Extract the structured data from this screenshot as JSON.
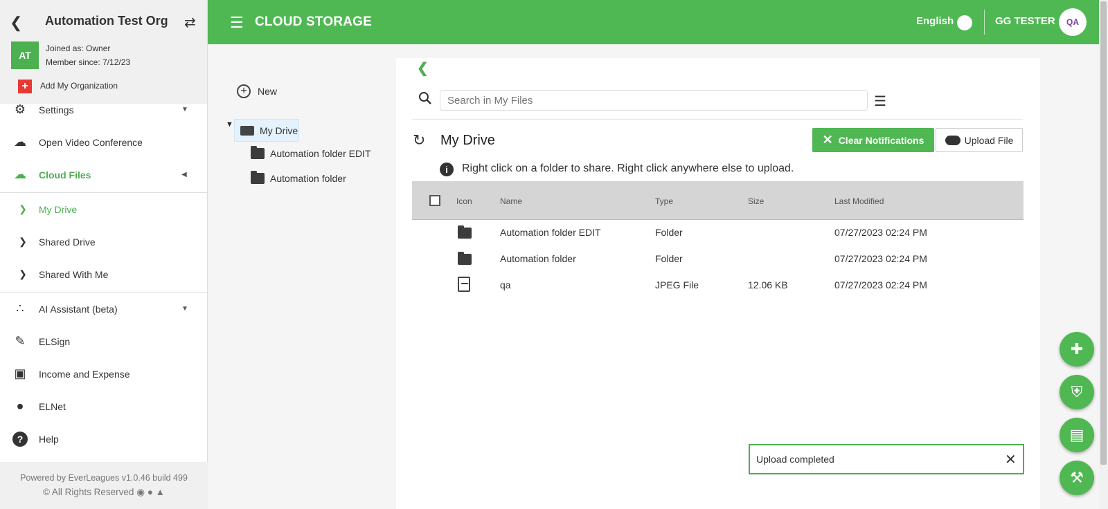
{
  "org": {
    "title": "Automation Test Org",
    "avatar_initials": "AT",
    "joined": "Joined as: Owner",
    "member_since": "Member since: 7/12/23",
    "add_org": "Add My Organization"
  },
  "sidebar": {
    "items": [
      {
        "label": "Settings",
        "icon": "gear-icon"
      },
      {
        "label": "Open Video Conference",
        "icon": "cloud-video-icon"
      },
      {
        "label": "Cloud Files",
        "icon": "cloud-icon"
      },
      {
        "label": "My Drive",
        "icon": "chevron-right-icon"
      },
      {
        "label": "Shared Drive",
        "icon": "chevron-right-icon"
      },
      {
        "label": "Shared With Me",
        "icon": "chevron-right-icon"
      },
      {
        "label": "AI Assistant (beta)",
        "icon": "ai-icon"
      },
      {
        "label": "ELSign",
        "icon": "pen-icon"
      },
      {
        "label": "Income and Expense",
        "icon": "wallet-icon"
      },
      {
        "label": "ELNet",
        "icon": "network-icon"
      },
      {
        "label": "Help",
        "icon": "help-icon"
      }
    ]
  },
  "footer": {
    "powered": "Powered by EverLeagues v1.0.46 build 499",
    "rights": "© All Rights Reserved"
  },
  "topbar": {
    "title": "CLOUD STORAGE",
    "language": "English",
    "user": "GG TESTER",
    "user_avatar": "QA"
  },
  "tree": {
    "new_label": "New",
    "root": "My Drive",
    "folders": [
      "Automation folder EDIT",
      "Automation folder"
    ]
  },
  "main": {
    "search_placeholder": "Search in My Files",
    "drive_title": "My Drive",
    "clear_label": "Clear Notifications",
    "upload_label": "Upload File",
    "info_text": "Right click on a folder to share. Right click anywhere else to upload.",
    "columns": [
      "Icon",
      "Name",
      "Type",
      "Size",
      "Last Modified"
    ],
    "rows": [
      {
        "icon": "folder-icon",
        "name": "Automation folder EDIT",
        "type": "Folder",
        "size": "",
        "modified": "07/27/2023 02:24 PM"
      },
      {
        "icon": "folder-icon",
        "name": "Automation folder",
        "type": "Folder",
        "size": "",
        "modified": "07/27/2023 02:24 PM"
      },
      {
        "icon": "image-file-icon",
        "name": "qa",
        "type": "JPEG File",
        "size": "12.06 KB",
        "modified": "07/27/2023 02:24 PM"
      }
    ]
  },
  "toast": {
    "message": "Upload completed"
  },
  "colors": {
    "accent": "#4fb853",
    "selected_tree": "#e3f2fd",
    "header_row": "#d5d5d5"
  }
}
